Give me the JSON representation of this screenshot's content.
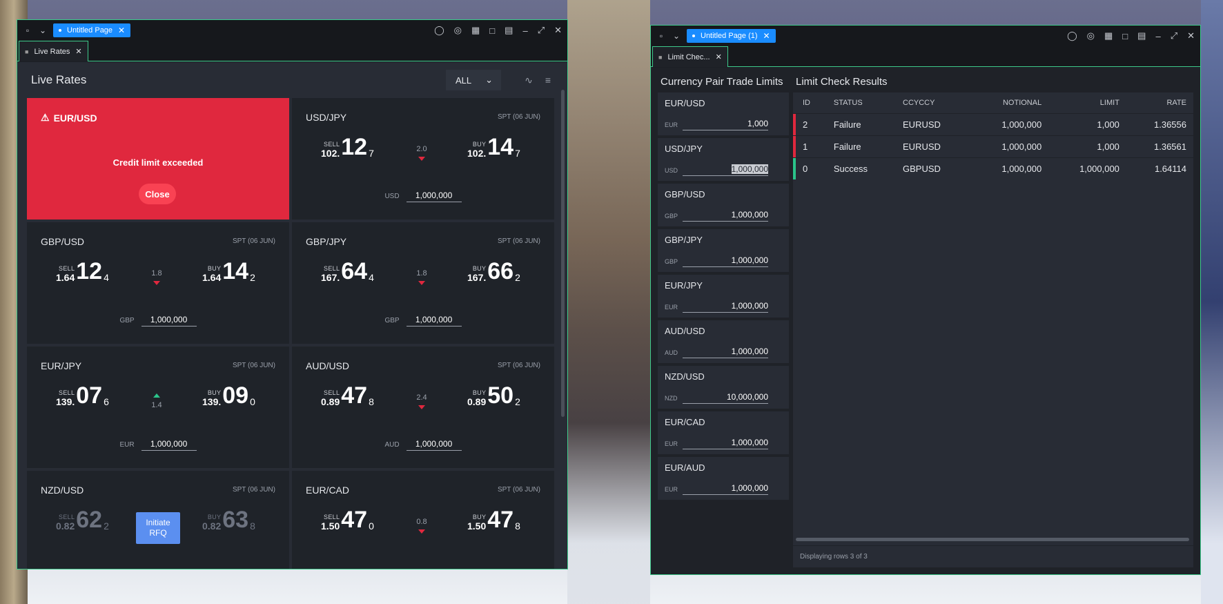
{
  "colors": {
    "accent": "#1a8cff",
    "alert": "#e0283e",
    "up": "#2bc48a",
    "down": "#e0283e",
    "border": "#3ecb8c"
  },
  "window1": {
    "page_tab": "Untitled Page",
    "view_tab": "Live Rates",
    "title": "Live Rates",
    "filter": "ALL",
    "alert_tile": {
      "pair": "EUR/USD",
      "message": "Credit limit exceeded",
      "button": "Close"
    },
    "tiles": [
      {
        "pair": "USD/JPY",
        "spot": "SPT (06 JUN)",
        "sell_big": "102.",
        "sell_pips": "12",
        "sell_frac": "7",
        "spread": "2.0",
        "buy_big": "102.",
        "buy_pips": "14",
        "buy_frac": "7",
        "ccy": "USD",
        "notional": "1,000,000",
        "dir": "down"
      },
      {
        "pair": "GBP/USD",
        "spot": "SPT (06 JUN)",
        "sell_big": "1.64",
        "sell_pips": "12",
        "sell_frac": "4",
        "spread": "1.8",
        "buy_big": "1.64",
        "buy_pips": "14",
        "buy_frac": "2",
        "ccy": "GBP",
        "notional": "1,000,000",
        "dir": "down"
      },
      {
        "pair": "GBP/JPY",
        "spot": "SPT (06 JUN)",
        "sell_big": "167.",
        "sell_pips": "64",
        "sell_frac": "4",
        "spread": "1.8",
        "buy_big": "167.",
        "buy_pips": "66",
        "buy_frac": "2",
        "ccy": "GBP",
        "notional": "1,000,000",
        "dir": "down"
      },
      {
        "pair": "EUR/JPY",
        "spot": "SPT (06 JUN)",
        "sell_big": "139.",
        "sell_pips": "07",
        "sell_frac": "6",
        "spread": "1.4",
        "buy_big": "139.",
        "buy_pips": "09",
        "buy_frac": "0",
        "ccy": "EUR",
        "notional": "1,000,000",
        "dir": "up"
      },
      {
        "pair": "AUD/USD",
        "spot": "SPT (06 JUN)",
        "sell_big": "0.89",
        "sell_pips": "47",
        "sell_frac": "8",
        "spread": "2.4",
        "buy_big": "0.89",
        "buy_pips": "50",
        "buy_frac": "2",
        "ccy": "AUD",
        "notional": "1,000,000",
        "dir": "down"
      },
      {
        "pair": "NZD/USD",
        "spot": "SPT (06 JUN)",
        "sell_big": "0.82",
        "sell_pips": "62",
        "sell_frac": "2",
        "buy_big": "0.82",
        "buy_pips": "63",
        "buy_frac": "8",
        "rfq": "Initiate RFQ"
      },
      {
        "pair": "EUR/CAD",
        "spot": "SPT (06 JUN)",
        "sell_big": "1.50",
        "sell_pips": "47",
        "sell_frac": "0",
        "spread": "0.8",
        "buy_big": "1.50",
        "buy_pips": "47",
        "buy_frac": "8",
        "dir": "down"
      }
    ],
    "sell_label": "SELL",
    "buy_label": "BUY"
  },
  "window2": {
    "page_tab": "Untitled Page (1)",
    "view_tab": "Limit Chec...",
    "left_title": "Currency Pair Trade Limits",
    "right_title": "Limit Check Results",
    "limits": [
      {
        "pair": "EUR/USD",
        "ccy": "EUR",
        "value": "1,000"
      },
      {
        "pair": "USD/JPY",
        "ccy": "USD",
        "value": "1,000,000",
        "selected": true
      },
      {
        "pair": "GBP/USD",
        "ccy": "GBP",
        "value": "1,000,000"
      },
      {
        "pair": "GBP/JPY",
        "ccy": "GBP",
        "value": "1,000,000"
      },
      {
        "pair": "EUR/JPY",
        "ccy": "EUR",
        "value": "1,000,000"
      },
      {
        "pair": "AUD/USD",
        "ccy": "AUD",
        "value": "1,000,000"
      },
      {
        "pair": "NZD/USD",
        "ccy": "NZD",
        "value": "10,000,000"
      },
      {
        "pair": "EUR/CAD",
        "ccy": "EUR",
        "value": "1,000,000"
      },
      {
        "pair": "EUR/AUD",
        "ccy": "EUR",
        "value": "1,000,000"
      }
    ],
    "columns": [
      "ID",
      "STATUS",
      "CCYCCY",
      "NOTIONAL",
      "LIMIT",
      "RATE"
    ],
    "rows": [
      {
        "id": "2",
        "status": "Failure",
        "ccy": "EURUSD",
        "notional": "1,000,000",
        "limit": "1,000",
        "rate": "1.36556",
        "color": "#e0283e"
      },
      {
        "id": "1",
        "status": "Failure",
        "ccy": "EURUSD",
        "notional": "1,000,000",
        "limit": "1,000",
        "rate": "1.36561",
        "color": "#e0283e"
      },
      {
        "id": "0",
        "status": "Success",
        "ccy": "GBPUSD",
        "notional": "1,000,000",
        "limit": "1,000,000",
        "rate": "1.64114",
        "color": "#2bc48a"
      }
    ],
    "footer": "Displaying rows 3 of 3"
  }
}
